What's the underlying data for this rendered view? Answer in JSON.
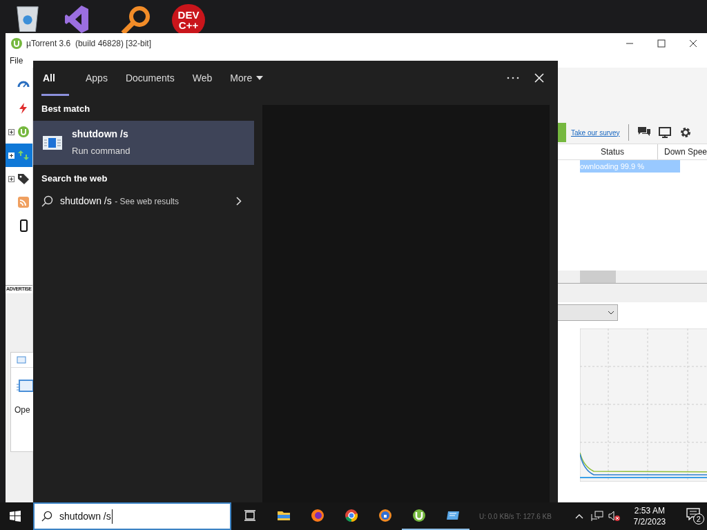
{
  "desktop": {
    "dev_icon_lines": [
      "DEV",
      "C++"
    ]
  },
  "utorrent": {
    "title": "µTorrent 3.6  (build 46828) [32-bit]",
    "menu": [
      "File"
    ],
    "sidebar": {
      "items": [
        {
          "kind": "speed",
          "expandable": false,
          "selected": false
        },
        {
          "kind": "bolt",
          "expandable": false,
          "selected": false
        },
        {
          "kind": "logo",
          "expandable": true,
          "selected": false
        },
        {
          "kind": "transfer",
          "expandable": true,
          "selected": true
        },
        {
          "kind": "tag",
          "expandable": true,
          "selected": false
        },
        {
          "kind": "rss",
          "expandable": false,
          "selected": false
        },
        {
          "kind": "phone",
          "expandable": false,
          "selected": false
        }
      ]
    },
    "ad_label": "ADVERTISE",
    "popup_text": "Ope",
    "survey_link": "Take our survey",
    "table": {
      "columns": [
        "Status",
        "Down Spee"
      ],
      "rows": [
        {
          "status": "ownloading 99.9 %",
          "selected": true
        }
      ]
    },
    "status_text": "U: 0.0 KB/s T: 127.6 KB"
  },
  "search_flyout": {
    "tabs": [
      {
        "label": "All",
        "selected": true,
        "kind": "plain"
      },
      {
        "label": "Apps",
        "selected": false,
        "kind": "plain"
      },
      {
        "label": "Documents",
        "selected": false,
        "kind": "plain"
      },
      {
        "label": "Web",
        "selected": false,
        "kind": "plain"
      },
      {
        "label": "More",
        "selected": false,
        "kind": "dropdown"
      }
    ],
    "best_match_heading": "Best match",
    "best_match": {
      "title": "shutdown /s",
      "subtitle": "Run command",
      "selected": true
    },
    "web_heading": "Search the web",
    "web_result": {
      "query": "shutdown /s",
      "hint": "- See web results"
    }
  },
  "taskbar": {
    "search_value": "shutdown /s",
    "clock": {
      "time": "2:53 AM",
      "date": "7/2/2023"
    },
    "notifications_badge": "2",
    "apps": [
      {
        "kind": "taskview",
        "running": false
      },
      {
        "kind": "folder",
        "running": false
      },
      {
        "kind": "firefox",
        "running": false
      },
      {
        "kind": "chrome",
        "running": false
      },
      {
        "kind": "shield",
        "running": false
      },
      {
        "kind": "utorrent",
        "running": true
      },
      {
        "kind": "window",
        "running": true
      }
    ]
  }
}
